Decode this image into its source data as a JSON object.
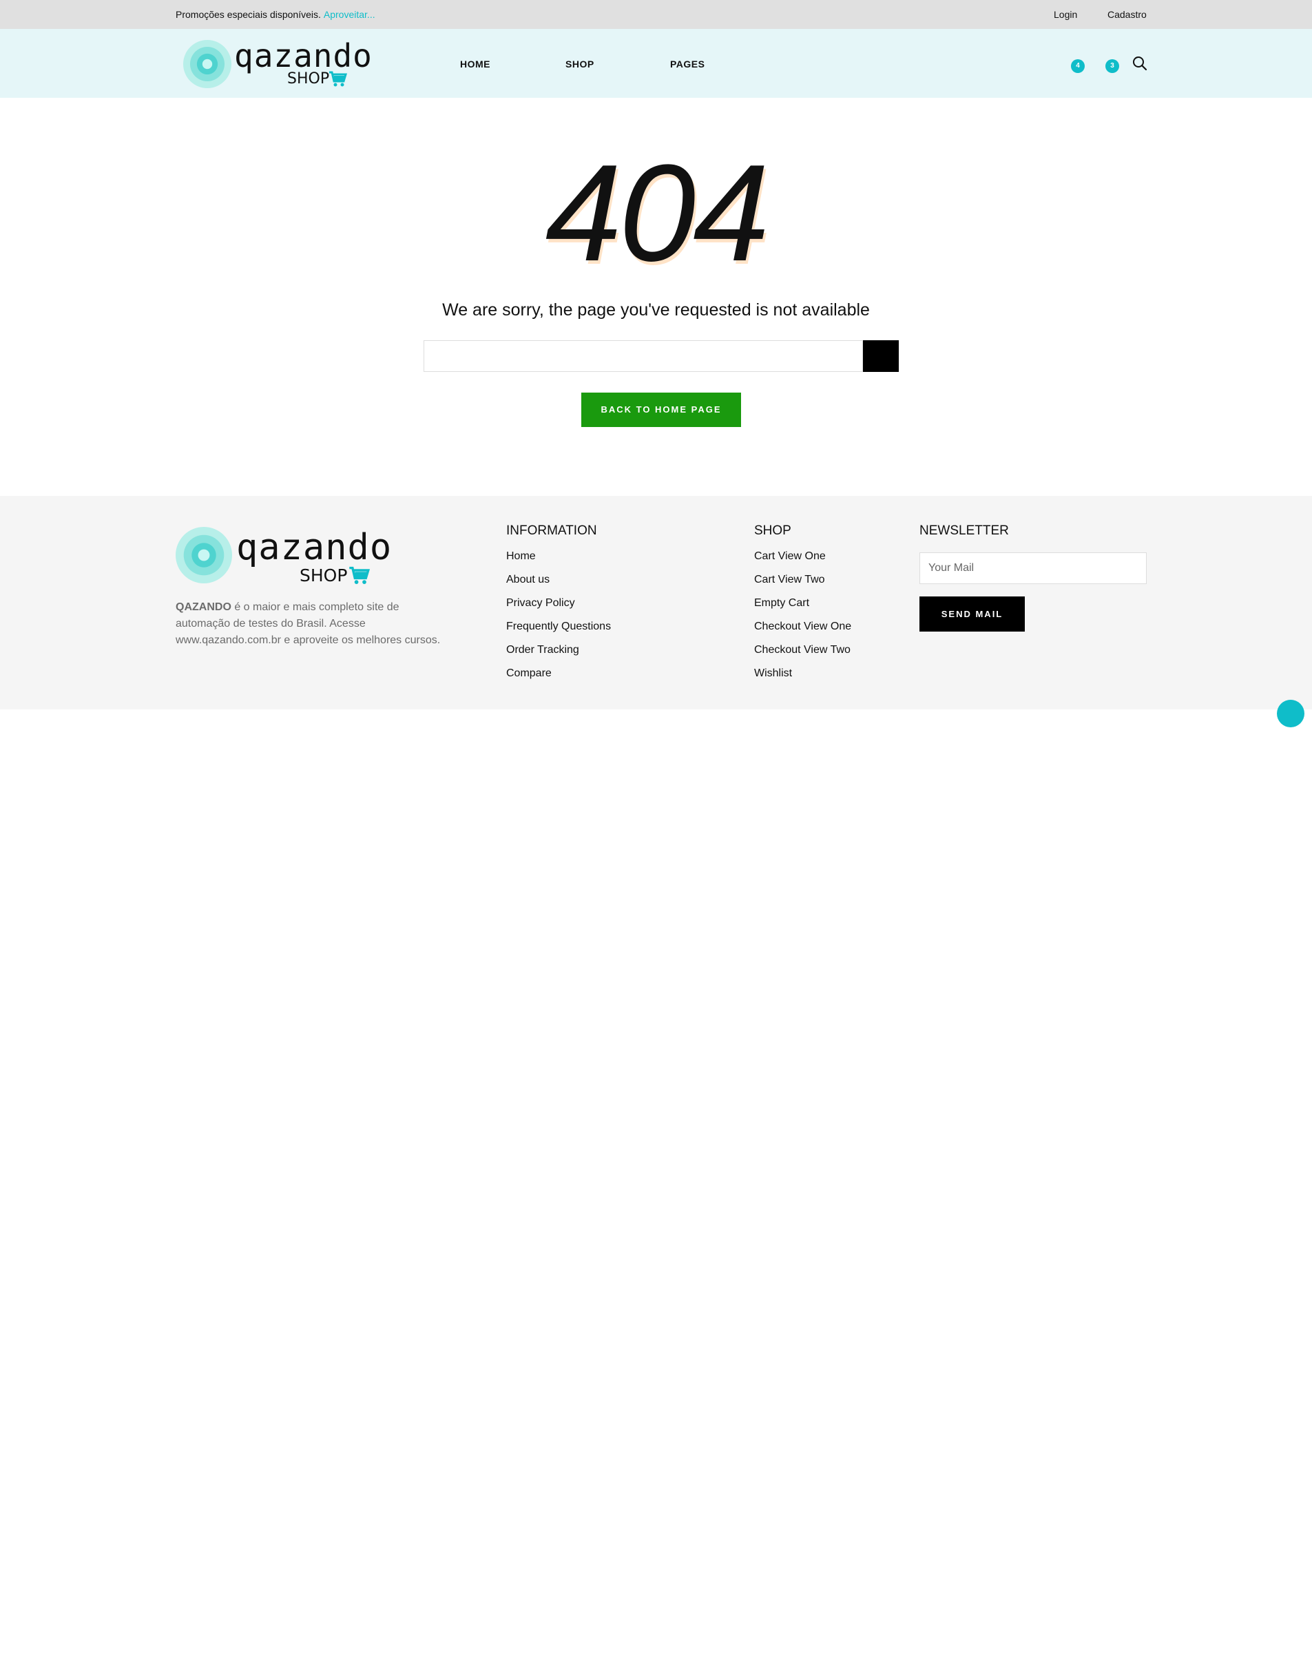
{
  "topbar": {
    "promo_text": "Promoções especiais disponíveis.",
    "promo_link": "Aproveitar...",
    "login": "Login",
    "cadastro": "Cadastro"
  },
  "header": {
    "logo_word": "qazando",
    "logo_shop": "SHOP",
    "nav": [
      "HOME",
      "SHOP",
      "PAGES"
    ],
    "wishlist_count": "4",
    "cart_count": "3"
  },
  "error": {
    "code": "404",
    "message": "We are sorry, the page you've requested is not available",
    "search_value": "",
    "back_button": "BACK TO HOME PAGE"
  },
  "footer": {
    "logo_word": "qazando",
    "logo_shop": "SHOP",
    "desc_bold": "QAZANDO",
    "desc_text": " é o maior e mais completo site de automação de testes do Brasil. Acesse www.qazando.com.br e aproveite os melhores cursos.",
    "information": {
      "title": "INFORMATION",
      "links": [
        "Home",
        "About us",
        "Privacy Policy",
        "Frequently Questions",
        "Order Tracking",
        "Compare"
      ]
    },
    "shop": {
      "title": "SHOP",
      "links": [
        "Cart View One",
        "Cart View Two",
        "Empty Cart",
        "Checkout View One",
        "Checkout View Two",
        "Wishlist"
      ]
    },
    "newsletter": {
      "title": "NEWSLETTER",
      "placeholder": "Your Mail",
      "button": "SEND MAIL"
    }
  },
  "colors": {
    "accent": "#0fbdc9",
    "header_bg": "#e5f6f8",
    "topbar_bg": "#e0e0e0",
    "back_button_bg": "#1a9a0e",
    "footer_bg": "#f5f5f5"
  }
}
